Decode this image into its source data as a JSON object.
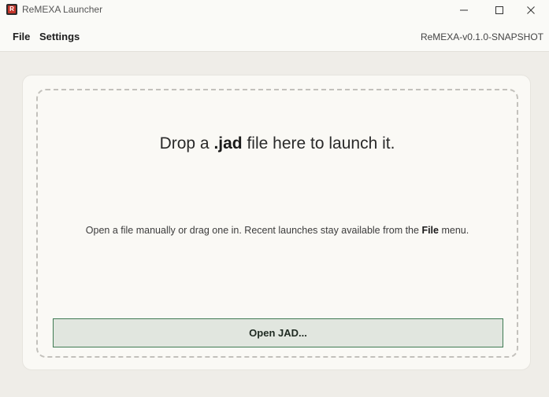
{
  "window": {
    "title": "ReMEXA Launcher",
    "app_icon_glyph": "R"
  },
  "menubar": {
    "file_label": "File",
    "settings_label": "Settings",
    "version": "ReMEXA-v0.1.0-SNAPSHOT"
  },
  "dropzone": {
    "title_before": "Drop a ",
    "title_ext": ".jad",
    "title_after": " file here to launch it.",
    "subtitle_before": "Open a file manually or drag one in. Recent launches stay available from the ",
    "subtitle_menu": "File",
    "subtitle_after": " menu.",
    "open_button_label": "Open JAD..."
  },
  "colors": {
    "accent_border": "#3f7a52",
    "button_bg": "#e1e6df",
    "app_icon": "#c4352a"
  },
  "icons": [
    "app-icon",
    "minimize-icon",
    "maximize-icon",
    "close-icon"
  ]
}
